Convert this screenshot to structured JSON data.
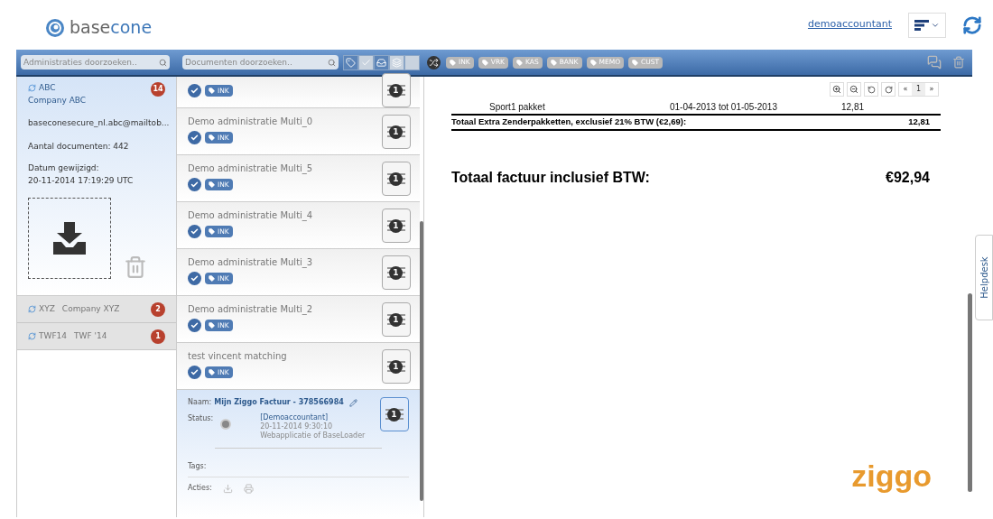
{
  "header": {
    "logo": {
      "part1": "base",
      "part2": "cone"
    },
    "user_link": "demoaccountant"
  },
  "toolbar": {
    "admin_search": {
      "placeholder": "Administraties doorzoeken.."
    },
    "doc_search": {
      "placeholder": "Documenten doorzoeken.."
    },
    "filters": [
      {
        "kind": "tag",
        "selected": true
      },
      {
        "kind": "check",
        "selected": false
      },
      {
        "kind": "inbox",
        "selected": true
      },
      {
        "kind": "layers",
        "selected": false
      },
      {
        "kind": "blank",
        "selected": false
      }
    ],
    "tags": [
      "INK",
      "VRK",
      "KAS",
      "BANK",
      "MEMO",
      "CUST"
    ]
  },
  "administrations": [
    {
      "code": "ABC",
      "name": "Company ABC",
      "count": "14",
      "selected": true,
      "email": "baseconesecure_nl.abc@mailtob...",
      "documents": "Aantal documenten: 442",
      "modified_label": "Datum gewijzigd:",
      "modified": "20-11-2014 17:19:29 UTC"
    },
    {
      "code": "XYZ",
      "name": "Company XYZ",
      "count": "2",
      "selected": false
    },
    {
      "code": "TWF14",
      "name": "TWF '14",
      "count": "1",
      "selected": false
    }
  ],
  "documents": [
    {
      "tag": "INK",
      "checked": true,
      "pages": "1"
    },
    {
      "title": "Demo administratie Multi_0",
      "tag": "INK",
      "checked": true,
      "pages": "1"
    },
    {
      "title": "Demo administratie Multi_5",
      "tag": "INK",
      "checked": true,
      "pages": "1"
    },
    {
      "title": "Demo administratie Multi_4",
      "tag": "INK",
      "checked": true,
      "pages": "1"
    },
    {
      "title": "Demo administratie Multi_3",
      "tag": "INK",
      "checked": true,
      "pages": "1"
    },
    {
      "title": "Demo administratie Multi_2",
      "tag": "INK",
      "checked": true,
      "pages": "1"
    },
    {
      "title": "test vincent matching",
      "tag": "INK",
      "checked": true,
      "pages": "1"
    }
  ],
  "selected_document": {
    "name_label": "Naam:",
    "name": "Mijn Ziggo Factuur - 378566984",
    "status_label": "Status:",
    "status_user": "[Demoaccountant]",
    "status_date": "20-11-2014 9:30:10",
    "status_source": "Webapplicatie of BaseLoader",
    "tags_label": "Tags:",
    "actions_label": "Acties:",
    "pages": "1"
  },
  "viewer": {
    "page": "1",
    "prev": "«",
    "next": "»",
    "invoice": {
      "line": {
        "item": "Sport1 pakket",
        "period": "01-04-2013 tot 01-05-2013",
        "amount": "12,81"
      },
      "subtotal": {
        "label": "Totaal Extra Zenderpakketten, exclusief 21% BTW (€2,69):",
        "amount": "12,81"
      },
      "total": {
        "label": "Totaal factuur inclusief BTW:",
        "amount": "€92,94"
      },
      "logo": "ziggo"
    }
  },
  "helpdesk": "Helpdesk"
}
